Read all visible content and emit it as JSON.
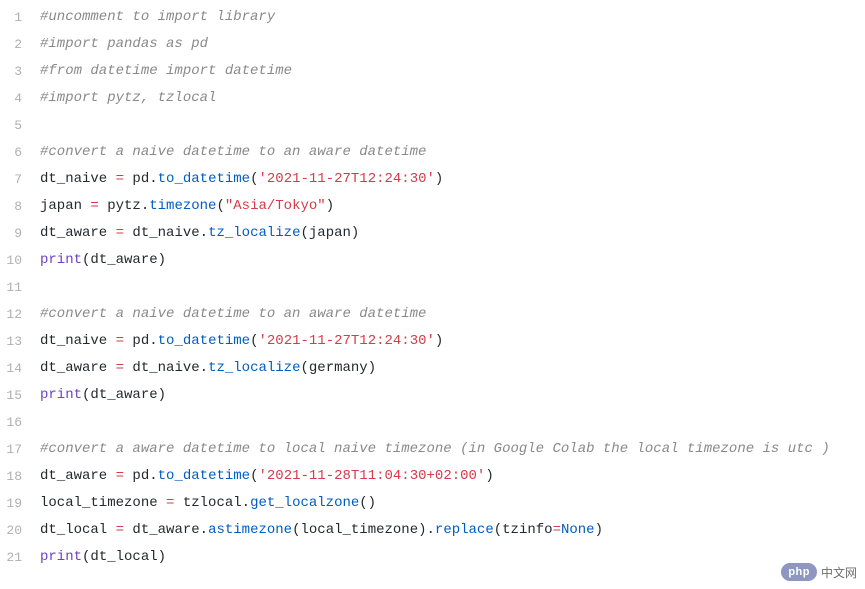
{
  "code": {
    "lines": [
      {
        "num": "1",
        "tokens": [
          {
            "cls": "c-comment",
            "t": "#uncomment to import library"
          }
        ]
      },
      {
        "num": "2",
        "tokens": [
          {
            "cls": "c-comment",
            "t": "#import pandas as pd"
          }
        ]
      },
      {
        "num": "3",
        "tokens": [
          {
            "cls": "c-comment",
            "t": "#from datetime import datetime"
          }
        ]
      },
      {
        "num": "4",
        "tokens": [
          {
            "cls": "c-comment",
            "t": "#import pytz, tzlocal"
          }
        ]
      },
      {
        "num": "5",
        "tokens": []
      },
      {
        "num": "6",
        "tokens": [
          {
            "cls": "c-comment",
            "t": "#convert a naive datetime to an aware datetime"
          }
        ]
      },
      {
        "num": "7",
        "tokens": [
          {
            "cls": "c-var",
            "t": "dt_naive "
          },
          {
            "cls": "c-op",
            "t": "="
          },
          {
            "cls": "c-var",
            "t": " pd"
          },
          {
            "cls": "c-paren",
            "t": "."
          },
          {
            "cls": "c-func",
            "t": "to_datetime"
          },
          {
            "cls": "c-paren",
            "t": "("
          },
          {
            "cls": "c-str",
            "t": "'2021-11-27T12:24:30'"
          },
          {
            "cls": "c-paren",
            "t": ")"
          }
        ]
      },
      {
        "num": "8",
        "tokens": [
          {
            "cls": "c-var",
            "t": "japan "
          },
          {
            "cls": "c-op",
            "t": "="
          },
          {
            "cls": "c-var",
            "t": " pytz"
          },
          {
            "cls": "c-paren",
            "t": "."
          },
          {
            "cls": "c-func",
            "t": "timezone"
          },
          {
            "cls": "c-paren",
            "t": "("
          },
          {
            "cls": "c-str",
            "t": "\"Asia/Tokyo\""
          },
          {
            "cls": "c-paren",
            "t": ")"
          }
        ]
      },
      {
        "num": "9",
        "tokens": [
          {
            "cls": "c-var",
            "t": "dt_aware "
          },
          {
            "cls": "c-op",
            "t": "="
          },
          {
            "cls": "c-var",
            "t": " dt_naive"
          },
          {
            "cls": "c-paren",
            "t": "."
          },
          {
            "cls": "c-func",
            "t": "tz_localize"
          },
          {
            "cls": "c-paren",
            "t": "("
          },
          {
            "cls": "c-var",
            "t": "japan"
          },
          {
            "cls": "c-paren",
            "t": ")"
          }
        ]
      },
      {
        "num": "10",
        "tokens": [
          {
            "cls": "c-print",
            "t": "print"
          },
          {
            "cls": "c-paren",
            "t": "("
          },
          {
            "cls": "c-var",
            "t": "dt_aware"
          },
          {
            "cls": "c-paren",
            "t": ")"
          }
        ]
      },
      {
        "num": "11",
        "tokens": []
      },
      {
        "num": "12",
        "tokens": [
          {
            "cls": "c-comment",
            "t": "#convert a naive datetime to an aware datetime"
          }
        ]
      },
      {
        "num": "13",
        "tokens": [
          {
            "cls": "c-var",
            "t": "dt_naive "
          },
          {
            "cls": "c-op",
            "t": "="
          },
          {
            "cls": "c-var",
            "t": " pd"
          },
          {
            "cls": "c-paren",
            "t": "."
          },
          {
            "cls": "c-func",
            "t": "to_datetime"
          },
          {
            "cls": "c-paren",
            "t": "("
          },
          {
            "cls": "c-str",
            "t": "'2021-11-27T12:24:30'"
          },
          {
            "cls": "c-paren",
            "t": ")"
          }
        ]
      },
      {
        "num": "14",
        "tokens": [
          {
            "cls": "c-var",
            "t": "dt_aware "
          },
          {
            "cls": "c-op",
            "t": "="
          },
          {
            "cls": "c-var",
            "t": " dt_naive"
          },
          {
            "cls": "c-paren",
            "t": "."
          },
          {
            "cls": "c-func",
            "t": "tz_localize"
          },
          {
            "cls": "c-paren",
            "t": "("
          },
          {
            "cls": "c-var",
            "t": "germany"
          },
          {
            "cls": "c-paren",
            "t": ")"
          }
        ]
      },
      {
        "num": "15",
        "tokens": [
          {
            "cls": "c-print",
            "t": "print"
          },
          {
            "cls": "c-paren",
            "t": "("
          },
          {
            "cls": "c-var",
            "t": "dt_aware"
          },
          {
            "cls": "c-paren",
            "t": ")"
          }
        ]
      },
      {
        "num": "16",
        "tokens": []
      },
      {
        "num": "17",
        "tokens": [
          {
            "cls": "c-comment",
            "t": "#convert a aware datetime to local naive timezone (in Google Colab the local timezone is utc )"
          }
        ]
      },
      {
        "num": "18",
        "tokens": [
          {
            "cls": "c-var",
            "t": "dt_aware "
          },
          {
            "cls": "c-op",
            "t": "="
          },
          {
            "cls": "c-var",
            "t": " pd"
          },
          {
            "cls": "c-paren",
            "t": "."
          },
          {
            "cls": "c-func",
            "t": "to_datetime"
          },
          {
            "cls": "c-paren",
            "t": "("
          },
          {
            "cls": "c-str",
            "t": "'2021-11-28T11:04:30+02:00'"
          },
          {
            "cls": "c-paren",
            "t": ")"
          }
        ]
      },
      {
        "num": "19",
        "tokens": [
          {
            "cls": "c-var",
            "t": "local_timezone "
          },
          {
            "cls": "c-op",
            "t": "="
          },
          {
            "cls": "c-var",
            "t": " tzlocal"
          },
          {
            "cls": "c-paren",
            "t": "."
          },
          {
            "cls": "c-func",
            "t": "get_localzone"
          },
          {
            "cls": "c-paren",
            "t": "()"
          }
        ]
      },
      {
        "num": "20",
        "tokens": [
          {
            "cls": "c-var",
            "t": "dt_local "
          },
          {
            "cls": "c-op",
            "t": "="
          },
          {
            "cls": "c-var",
            "t": " dt_aware"
          },
          {
            "cls": "c-paren",
            "t": "."
          },
          {
            "cls": "c-func",
            "t": "astimezone"
          },
          {
            "cls": "c-paren",
            "t": "("
          },
          {
            "cls": "c-var",
            "t": "local_timezone"
          },
          {
            "cls": "c-paren",
            "t": ")"
          },
          {
            "cls": "c-paren",
            "t": "."
          },
          {
            "cls": "c-func",
            "t": "replace"
          },
          {
            "cls": "c-paren",
            "t": "("
          },
          {
            "cls": "c-var",
            "t": "tzinfo"
          },
          {
            "cls": "c-op",
            "t": "="
          },
          {
            "cls": "c-kw",
            "t": "None"
          },
          {
            "cls": "c-paren",
            "t": ")"
          }
        ]
      },
      {
        "num": "21",
        "tokens": [
          {
            "cls": "c-print",
            "t": "print"
          },
          {
            "cls": "c-paren",
            "t": "("
          },
          {
            "cls": "c-var",
            "t": "dt_local"
          },
          {
            "cls": "c-paren",
            "t": ")"
          }
        ]
      }
    ]
  },
  "watermark": {
    "badge": "php",
    "text": "中文网"
  }
}
